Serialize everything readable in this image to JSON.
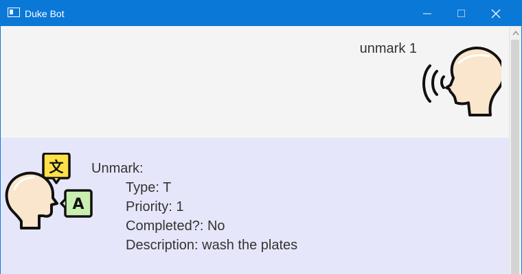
{
  "window": {
    "title": "Duke Bot",
    "accent": "#0a78d7"
  },
  "messages": {
    "user": {
      "text": "unmark 1",
      "background": "#f4f4f4",
      "avatar_icon": "speaking-head-icon"
    },
    "bot": {
      "heading": "Unmark:",
      "type": "Type: T",
      "priority": "Priority: 1",
      "completed": "Completed?: No",
      "description": "Description: wash the plates",
      "background": "#e6e6fa",
      "avatar_icon": "translator-head-icon",
      "badge_top": "文",
      "badge_bottom": "A"
    }
  }
}
